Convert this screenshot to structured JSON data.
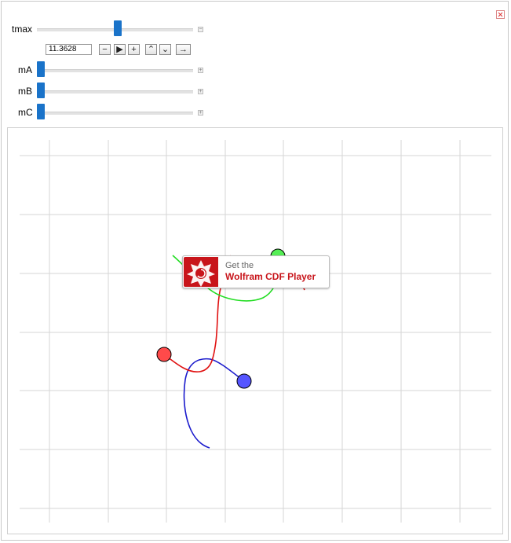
{
  "controls": {
    "tmax": {
      "label": "tmax",
      "value": "11.3628",
      "fraction": 0.52
    },
    "mA": {
      "label": "mA",
      "fraction": 0.0
    },
    "mB": {
      "label": "mB",
      "fraction": 0.0
    },
    "mC": {
      "label": "mC",
      "fraction": 0.0
    }
  },
  "animator": {
    "buttons": [
      "−",
      "▶",
      "+",
      "⌃",
      "⌄",
      "→"
    ]
  },
  "icons": {
    "close": "close-icon",
    "expand": "plus-icon",
    "collapse": "minus-icon"
  },
  "banner": {
    "line1": "Get the",
    "line2": "Wolfram CDF Player"
  },
  "colors": {
    "bodyA": "#ff4a4a",
    "bodyB": "#5555ff",
    "bodyC": "#55ee55",
    "thumb": "#1a73c9",
    "brand": "#c8151b"
  }
}
